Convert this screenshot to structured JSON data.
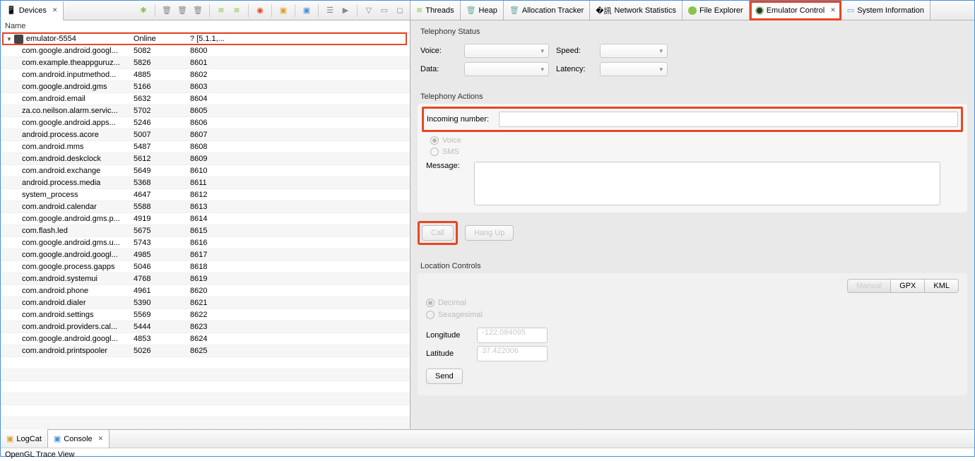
{
  "left": {
    "tab": "Devices",
    "header": "Name",
    "device": {
      "name": "emulator-5554",
      "status": "Online",
      "version": "? [5.1.1,..."
    },
    "rows": [
      {
        "name": "com.google.android.googl...",
        "a": "5082",
        "b": "8600"
      },
      {
        "name": "com.example.theappguruz...",
        "a": "5826",
        "b": "8601"
      },
      {
        "name": "com.android.inputmethod...",
        "a": "4885",
        "b": "8602"
      },
      {
        "name": "com.google.android.gms",
        "a": "5166",
        "b": "8603"
      },
      {
        "name": "com.android.email",
        "a": "5632",
        "b": "8604"
      },
      {
        "name": "za.co.neilson.alarm.servic...",
        "a": "5702",
        "b": "8605"
      },
      {
        "name": "com.google.android.apps...",
        "a": "5246",
        "b": "8606"
      },
      {
        "name": "android.process.acore",
        "a": "5007",
        "b": "8607"
      },
      {
        "name": "com.android.mms",
        "a": "5487",
        "b": "8608"
      },
      {
        "name": "com.android.deskclock",
        "a": "5612",
        "b": "8609"
      },
      {
        "name": "com.android.exchange",
        "a": "5649",
        "b": "8610"
      },
      {
        "name": "android.process.media",
        "a": "5368",
        "b": "8611"
      },
      {
        "name": "system_process",
        "a": "4647",
        "b": "8612"
      },
      {
        "name": "com.android.calendar",
        "a": "5588",
        "b": "8613"
      },
      {
        "name": "com.google.android.gms.p...",
        "a": "4919",
        "b": "8614"
      },
      {
        "name": "com.flash.led",
        "a": "5675",
        "b": "8615"
      },
      {
        "name": "com.google.android.gms.u...",
        "a": "5743",
        "b": "8616"
      },
      {
        "name": "com.google.android.googl...",
        "a": "4985",
        "b": "8617"
      },
      {
        "name": "com.google.process.gapps",
        "a": "5046",
        "b": "8618"
      },
      {
        "name": "com.android.systemui",
        "a": "4768",
        "b": "8619"
      },
      {
        "name": "com.android.phone",
        "a": "4961",
        "b": "8620"
      },
      {
        "name": "com.android.dialer",
        "a": "5390",
        "b": "8621"
      },
      {
        "name": "com.android.settings",
        "a": "5569",
        "b": "8622"
      },
      {
        "name": "com.android.providers.cal...",
        "a": "5444",
        "b": "8623"
      },
      {
        "name": "com.google.android.googl...",
        "a": "4853",
        "b": "8624"
      },
      {
        "name": "com.android.printspooler",
        "a": "5026",
        "b": "8625"
      }
    ]
  },
  "bottom": {
    "logcat": "LogCat",
    "console": "Console",
    "footer": "OpenGL Trace View"
  },
  "right": {
    "tabs": {
      "threads": "Threads",
      "heap": "Heap",
      "alloc": "Allocation Tracker",
      "net": "Network Statistics",
      "file": "File Explorer",
      "emu": "Emulator Control",
      "sys": "System Information"
    },
    "tel_status": "Telephony Status",
    "voice": "Voice:",
    "speed": "Speed:",
    "data": "Data:",
    "latency": "Latency:",
    "tel_actions": "Telephony Actions",
    "incoming": "Incoming number:",
    "voice_radio": "Voice",
    "sms_radio": "SMS",
    "message": "Message:",
    "call": "Call",
    "hangup": "Hang Up",
    "loc": "Location Controls",
    "seg": {
      "manual": "Manual",
      "gpx": "GPX",
      "kml": "KML"
    },
    "decimal": "Decimal",
    "sex": "Sexagesimal",
    "longitude": "Longitude",
    "lon_val": "-122.084095",
    "latitude": "Latitude",
    "lat_val": "37.422006",
    "send": "Send"
  }
}
